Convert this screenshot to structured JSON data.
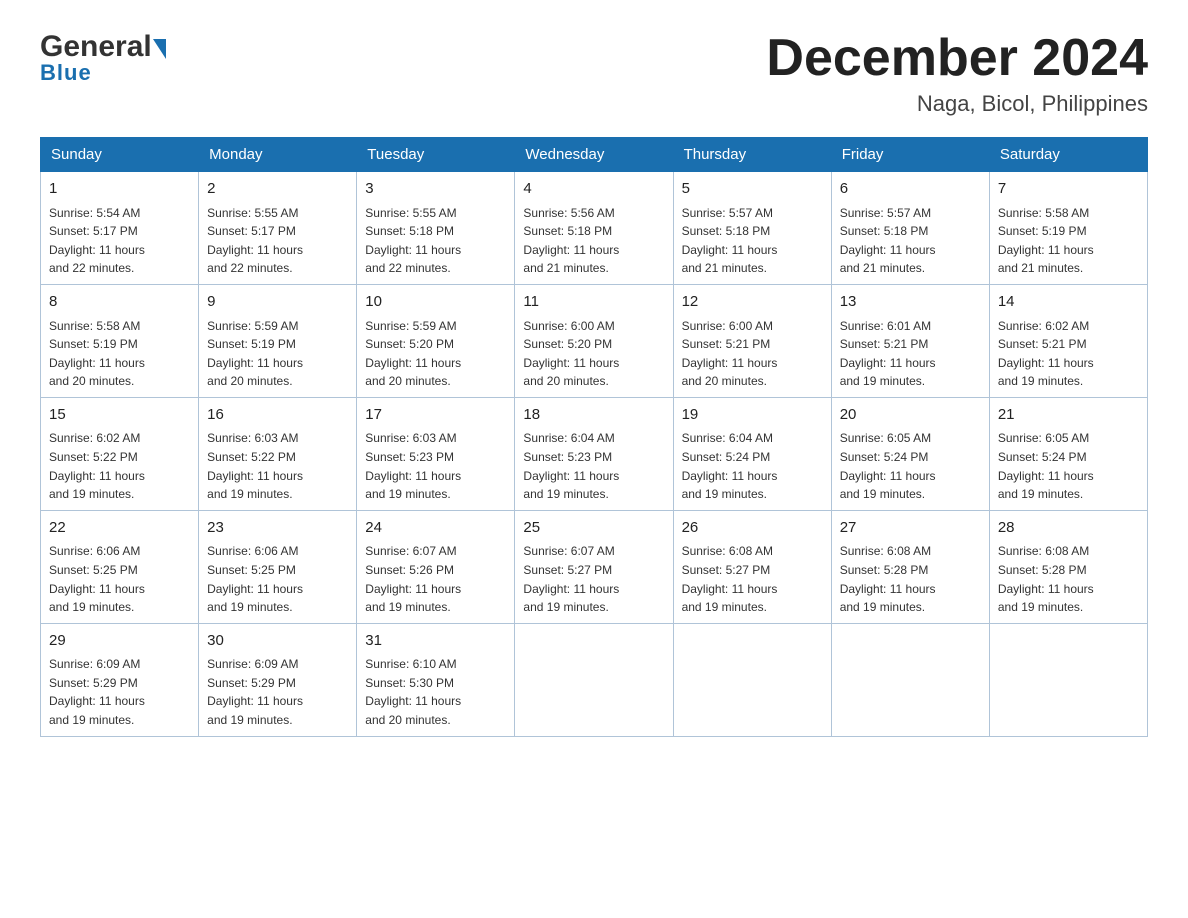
{
  "header": {
    "logo_general": "General",
    "logo_blue": "Blue",
    "month_title": "December 2024",
    "location": "Naga, Bicol, Philippines"
  },
  "days_of_week": [
    "Sunday",
    "Monday",
    "Tuesday",
    "Wednesday",
    "Thursday",
    "Friday",
    "Saturday"
  ],
  "weeks": [
    [
      {
        "date": "1",
        "sunrise": "5:54 AM",
        "sunset": "5:17 PM",
        "daylight": "11 hours and 22 minutes."
      },
      {
        "date": "2",
        "sunrise": "5:55 AM",
        "sunset": "5:17 PM",
        "daylight": "11 hours and 22 minutes."
      },
      {
        "date": "3",
        "sunrise": "5:55 AM",
        "sunset": "5:18 PM",
        "daylight": "11 hours and 22 minutes."
      },
      {
        "date": "4",
        "sunrise": "5:56 AM",
        "sunset": "5:18 PM",
        "daylight": "11 hours and 21 minutes."
      },
      {
        "date": "5",
        "sunrise": "5:57 AM",
        "sunset": "5:18 PM",
        "daylight": "11 hours and 21 minutes."
      },
      {
        "date": "6",
        "sunrise": "5:57 AM",
        "sunset": "5:18 PM",
        "daylight": "11 hours and 21 minutes."
      },
      {
        "date": "7",
        "sunrise": "5:58 AM",
        "sunset": "5:19 PM",
        "daylight": "11 hours and 21 minutes."
      }
    ],
    [
      {
        "date": "8",
        "sunrise": "5:58 AM",
        "sunset": "5:19 PM",
        "daylight": "11 hours and 20 minutes."
      },
      {
        "date": "9",
        "sunrise": "5:59 AM",
        "sunset": "5:19 PM",
        "daylight": "11 hours and 20 minutes."
      },
      {
        "date": "10",
        "sunrise": "5:59 AM",
        "sunset": "5:20 PM",
        "daylight": "11 hours and 20 minutes."
      },
      {
        "date": "11",
        "sunrise": "6:00 AM",
        "sunset": "5:20 PM",
        "daylight": "11 hours and 20 minutes."
      },
      {
        "date": "12",
        "sunrise": "6:00 AM",
        "sunset": "5:21 PM",
        "daylight": "11 hours and 20 minutes."
      },
      {
        "date": "13",
        "sunrise": "6:01 AM",
        "sunset": "5:21 PM",
        "daylight": "11 hours and 19 minutes."
      },
      {
        "date": "14",
        "sunrise": "6:02 AM",
        "sunset": "5:21 PM",
        "daylight": "11 hours and 19 minutes."
      }
    ],
    [
      {
        "date": "15",
        "sunrise": "6:02 AM",
        "sunset": "5:22 PM",
        "daylight": "11 hours and 19 minutes."
      },
      {
        "date": "16",
        "sunrise": "6:03 AM",
        "sunset": "5:22 PM",
        "daylight": "11 hours and 19 minutes."
      },
      {
        "date": "17",
        "sunrise": "6:03 AM",
        "sunset": "5:23 PM",
        "daylight": "11 hours and 19 minutes."
      },
      {
        "date": "18",
        "sunrise": "6:04 AM",
        "sunset": "5:23 PM",
        "daylight": "11 hours and 19 minutes."
      },
      {
        "date": "19",
        "sunrise": "6:04 AM",
        "sunset": "5:24 PM",
        "daylight": "11 hours and 19 minutes."
      },
      {
        "date": "20",
        "sunrise": "6:05 AM",
        "sunset": "5:24 PM",
        "daylight": "11 hours and 19 minutes."
      },
      {
        "date": "21",
        "sunrise": "6:05 AM",
        "sunset": "5:24 PM",
        "daylight": "11 hours and 19 minutes."
      }
    ],
    [
      {
        "date": "22",
        "sunrise": "6:06 AM",
        "sunset": "5:25 PM",
        "daylight": "11 hours and 19 minutes."
      },
      {
        "date": "23",
        "sunrise": "6:06 AM",
        "sunset": "5:25 PM",
        "daylight": "11 hours and 19 minutes."
      },
      {
        "date": "24",
        "sunrise": "6:07 AM",
        "sunset": "5:26 PM",
        "daylight": "11 hours and 19 minutes."
      },
      {
        "date": "25",
        "sunrise": "6:07 AM",
        "sunset": "5:27 PM",
        "daylight": "11 hours and 19 minutes."
      },
      {
        "date": "26",
        "sunrise": "6:08 AM",
        "sunset": "5:27 PM",
        "daylight": "11 hours and 19 minutes."
      },
      {
        "date": "27",
        "sunrise": "6:08 AM",
        "sunset": "5:28 PM",
        "daylight": "11 hours and 19 minutes."
      },
      {
        "date": "28",
        "sunrise": "6:08 AM",
        "sunset": "5:28 PM",
        "daylight": "11 hours and 19 minutes."
      }
    ],
    [
      {
        "date": "29",
        "sunrise": "6:09 AM",
        "sunset": "5:29 PM",
        "daylight": "11 hours and 19 minutes."
      },
      {
        "date": "30",
        "sunrise": "6:09 AM",
        "sunset": "5:29 PM",
        "daylight": "11 hours and 19 minutes."
      },
      {
        "date": "31",
        "sunrise": "6:10 AM",
        "sunset": "5:30 PM",
        "daylight": "11 hours and 20 minutes."
      },
      null,
      null,
      null,
      null
    ]
  ],
  "labels": {
    "sunrise": "Sunrise:",
    "sunset": "Sunset:",
    "daylight": "Daylight:"
  }
}
